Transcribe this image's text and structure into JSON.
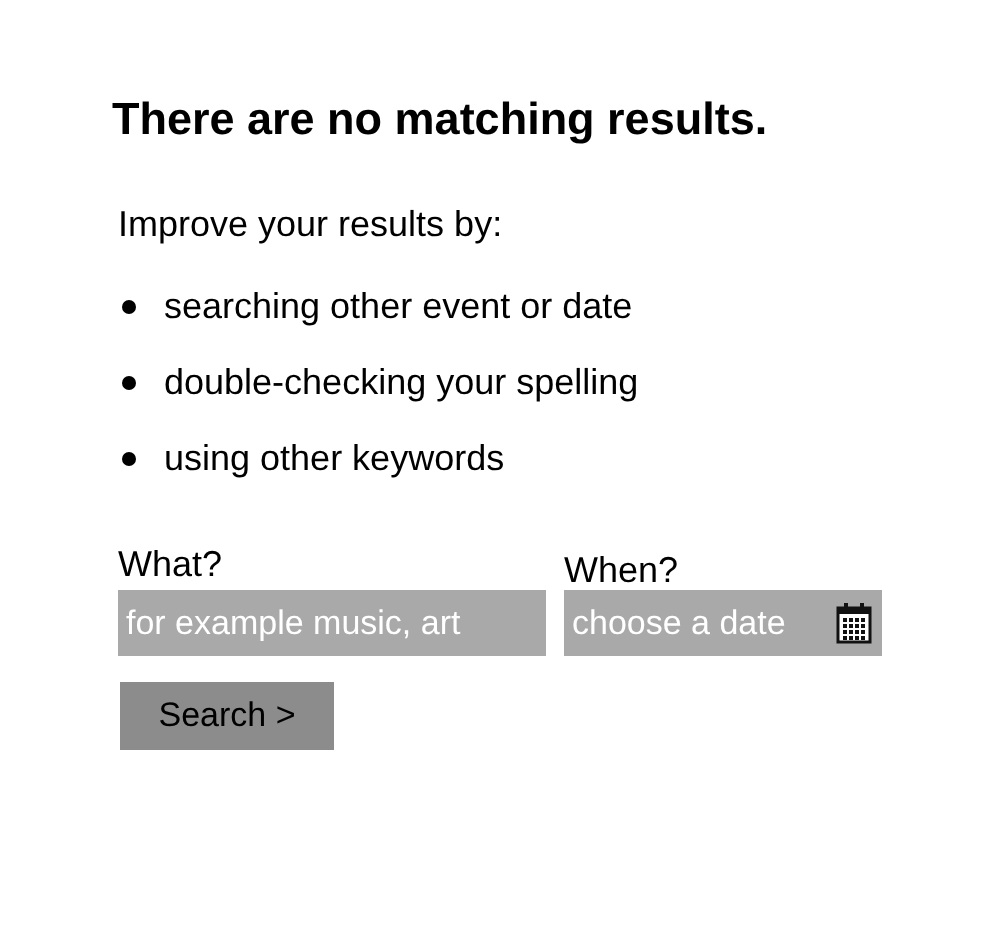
{
  "heading": "There are no matching results.",
  "intro": "Improve your results by:",
  "tips": [
    "searching other event or date",
    "double-checking your spelling",
    "using other keywords"
  ],
  "what": {
    "label": "What?",
    "placeholder": "for example music, art"
  },
  "when": {
    "label": "When?",
    "placeholder": "choose a date"
  },
  "search_button": "Search >"
}
